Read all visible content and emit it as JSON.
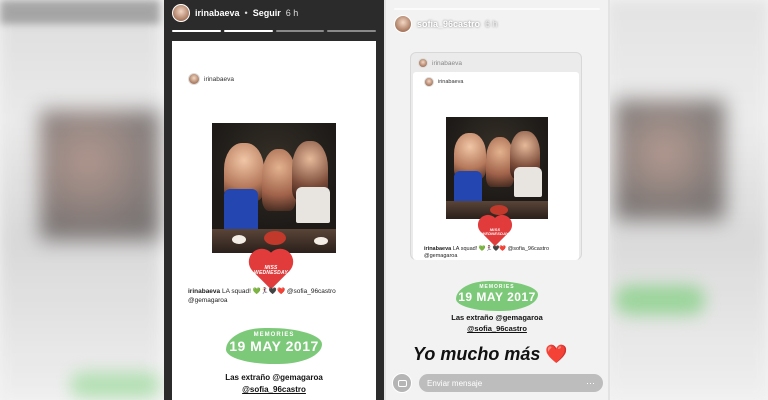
{
  "left_story": {
    "username": "irinabaeva",
    "separator": "•",
    "follow_label": "Seguir",
    "time": "6 h",
    "post": {
      "author": "irinabaeva",
      "sticker_text": "MISS\nWEDNESDAY",
      "caption_user": "irinabaeva",
      "caption_text": "LA squad! 💚🏃‍♀️🖤❤️ @sofia_96castro",
      "caption_mention": "@gemagaroa"
    },
    "memories_label": "MEMORIES",
    "memories_date": "19 MAY 2017",
    "extrano_line1": "Las extraño @gemagaroa",
    "extrano_line2": "@sofia_96castro"
  },
  "right_story": {
    "username": "sofia_96castro",
    "time": "6 h",
    "quoted_author": "irinabaeva",
    "quoted_inner_author": "irinabaeva",
    "caption_user": "irinabaeva",
    "caption_text": "LA squad! 💚🏃‍♀️🖤❤️ @sofia_96castro",
    "caption_mention": "@gemagaroa",
    "memories_label": "MEMORIES",
    "memories_date": "19 MAY 2017",
    "extrano_line1": "Las extraño @gemagaroa",
    "extrano_line2": "@sofia_96castro",
    "overlay_text": "Yo mucho más",
    "overlay_emoji": "❤️",
    "message_placeholder": "Enviar mensaje",
    "message_more": "⋯"
  },
  "colors": {
    "memories_green": "#7dc97a",
    "sticker_red": "#e23b3b",
    "dress_blue": "#2346b0"
  }
}
